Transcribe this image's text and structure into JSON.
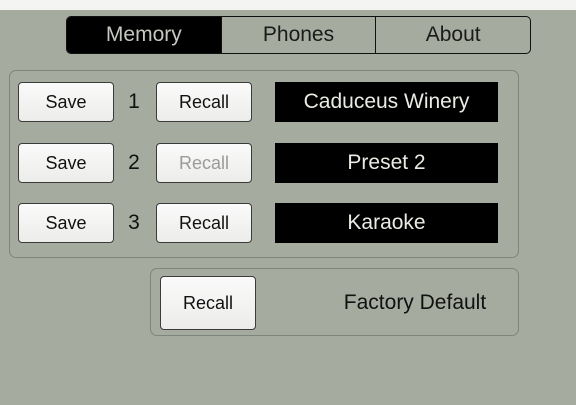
{
  "tabs": [
    {
      "label": "Memory",
      "active": true
    },
    {
      "label": "Phones",
      "active": false
    },
    {
      "label": "About",
      "active": false
    }
  ],
  "presets": [
    {
      "save_label": "Save",
      "number": "1",
      "recall_label": "Recall",
      "recall_enabled": true,
      "name": "Caduceus Winery"
    },
    {
      "save_label": "Save",
      "number": "2",
      "recall_label": "Recall",
      "recall_enabled": false,
      "name": "Preset 2"
    },
    {
      "save_label": "Save",
      "number": "3",
      "recall_label": "Recall",
      "recall_enabled": true,
      "name": "Karaoke"
    }
  ],
  "factory": {
    "recall_label": "Recall",
    "label": "Factory Default"
  },
  "colors": {
    "background": "#a6ab9f",
    "active_tab": "#000000",
    "name_box": "#000000"
  }
}
